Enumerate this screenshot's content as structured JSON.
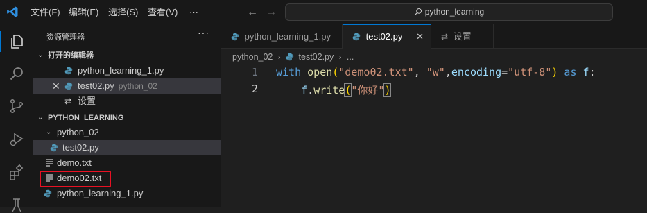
{
  "menu": {
    "file": "文件(F)",
    "edit": "编辑(E)",
    "selection": "选择(S)",
    "view": "查看(V)",
    "more": "···"
  },
  "search": {
    "text": "python_learning"
  },
  "explorer": {
    "title": "资源管理器",
    "more": "···",
    "open_editors_label": "打开的编辑器",
    "open_editors": [
      {
        "name": "python_learning_1.py",
        "type": "python"
      },
      {
        "name": "test02.py",
        "hint": "python_02",
        "type": "python",
        "selected": true
      },
      {
        "name": "设置",
        "type": "settings"
      }
    ],
    "workspace_label": "PYTHON_LEARNING",
    "folder": "python_02",
    "files": [
      {
        "name": "test02.py",
        "type": "python",
        "selected": true
      },
      {
        "name": "demo.txt",
        "type": "text"
      },
      {
        "name": "demo02.txt",
        "type": "text",
        "highlighted": true
      },
      {
        "name": "python_learning_1.py",
        "type": "python"
      }
    ]
  },
  "tabs": [
    {
      "label": "python_learning_1.py",
      "type": "python"
    },
    {
      "label": "test02.py",
      "type": "python",
      "active": true
    },
    {
      "label": "设置",
      "type": "settings"
    }
  ],
  "breadcrumb": {
    "folder": "python_02",
    "file": "test02.py",
    "more": "..."
  },
  "editor": {
    "line_numbers": [
      "1",
      "2"
    ],
    "line1": {
      "kw_with": "with",
      "fn_open": "open",
      "p1": "(",
      "s1": "\"demo02.txt\"",
      "c1": ", ",
      "s2": "\"w\"",
      "c2": ",",
      "param": "encoding",
      "eq": "=",
      "s3": "\"utf-8\"",
      "p2": ")",
      "kw_as": " as ",
      "var": "f",
      "colon": ":"
    },
    "line2": {
      "obj": "f",
      "dot": ".",
      "fn": "write",
      "p1": "(",
      "s": "\"你好\"",
      "p2": ")"
    }
  },
  "icons": [
    "explorer-icon",
    "search-icon",
    "source-control-icon",
    "run-debug-icon",
    "extensions-icon",
    "testing-icon"
  ],
  "colors": {
    "accent": "#0078d4",
    "highlight_box": "#e81123",
    "python_icon": "#519aba"
  }
}
